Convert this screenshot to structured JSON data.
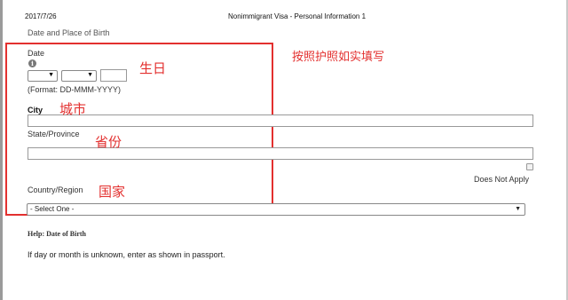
{
  "header": {
    "print_date": "2017/7/26",
    "page_title": "Nonimmigrant Visa - Personal Information 1"
  },
  "section": {
    "title": "Date and Place of Birth"
  },
  "form": {
    "date_label": "Date",
    "date_format_hint": "(Format: DD-MMM-YYYY)",
    "day_select_value": "",
    "month_select_value": "",
    "year_value": "",
    "city_label": "City",
    "city_value": "",
    "state_label": "State/Province",
    "state_value": "",
    "does_not_apply_label": "Does Not Apply",
    "does_not_apply_checked": false,
    "country_label": "Country/Region",
    "country_selected": "- Select One -"
  },
  "annotations": {
    "birthday": "生日",
    "city": "城市",
    "province": "省份",
    "country": "国家",
    "passport_note": "按照护照如实填写",
    "color": "#e3302f"
  },
  "help": {
    "title": "Help: Date of Birth",
    "text": "If day or month is unknown, enter as shown in passport."
  },
  "icons": {
    "info": "info-icon",
    "dropdown": "chevron-down-icon"
  }
}
